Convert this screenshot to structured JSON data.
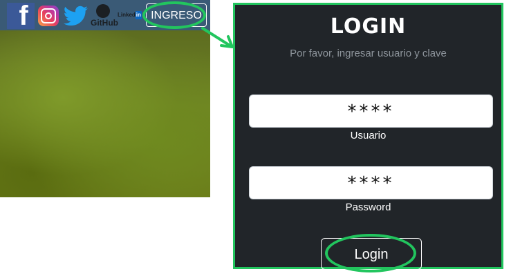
{
  "navbar": {
    "social": [
      {
        "name": "facebook",
        "icon": "facebook-icon",
        "glyph": "f"
      },
      {
        "name": "instagram",
        "icon": "instagram-icon"
      },
      {
        "name": "twitter",
        "icon": "twitter-icon"
      },
      {
        "name": "github",
        "icon": "github-icon",
        "label": "GitHub"
      },
      {
        "name": "linkedin",
        "icon": "linkedin-icon",
        "label_prefix": "Linked",
        "label_suffix": "in"
      }
    ],
    "ingreso_label": "INGRESO"
  },
  "login": {
    "title": "LOGIN",
    "subtitle": "Por favor, ingresar usuario y clave",
    "username": {
      "value": "****",
      "label": "Usuario"
    },
    "password": {
      "value": "****",
      "label": "Password"
    },
    "submit_label": "Login"
  },
  "colors": {
    "highlight": "#22c55e",
    "panel_bg": "#212529",
    "navbar_bg": "#3a5a76",
    "facebook": "#3b5998",
    "linkedin": "#0a66c2"
  }
}
